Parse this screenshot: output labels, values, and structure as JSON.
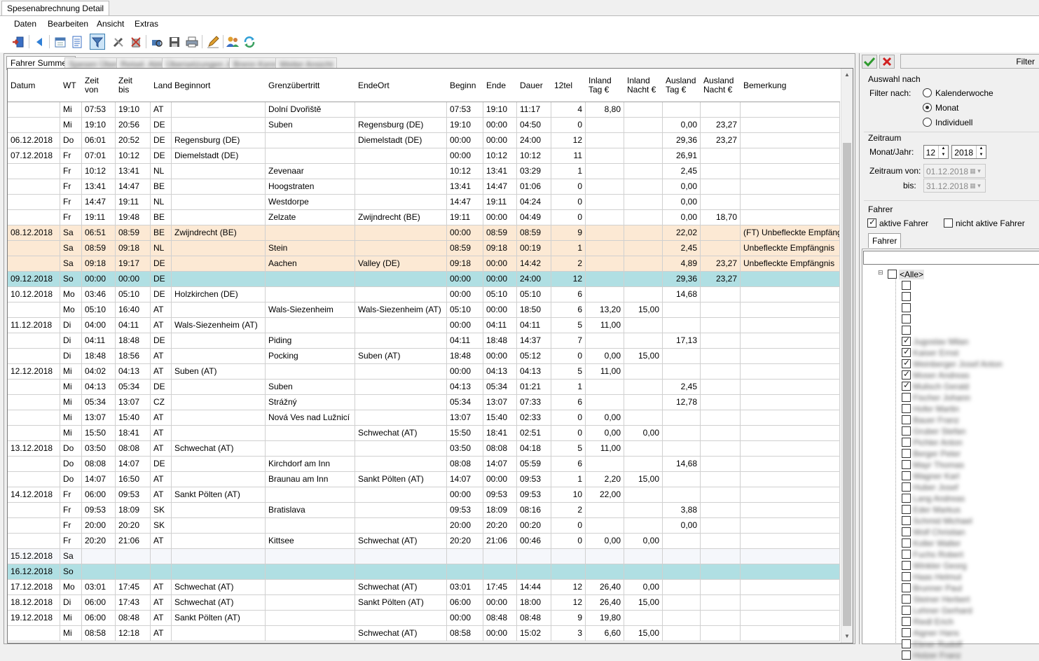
{
  "window": {
    "title": "Spesenabrechnung Detail"
  },
  "menu": [
    "Daten",
    "Bearbeiten",
    "Ansicht",
    "Extras"
  ],
  "toolbar": [
    "exit-icon",
    "back-icon",
    "calendar-icon",
    "document-icon",
    "filter-icon",
    "tools-icon",
    "delete-icon",
    "print-preview-icon",
    "save-icon",
    "print-icon",
    "edit-icon",
    "users-icon",
    "refresh-icon"
  ],
  "tabs": [
    "Fahrer Summen",
    "Spesen Übers",
    "Reisel. Ablst",
    "Übersetzungen Jeo",
    "Brenn Kennz",
    "Weiter Ansicht"
  ],
  "columns": [
    "Datum",
    "WT",
    "Zeit\nvon",
    "Zeit\nbis",
    "Land",
    "Beginnort",
    "Grenzübertritt",
    "EndeOrt",
    "Beginn",
    "Ende",
    "Dauer",
    "12tel",
    "Inland\nTag €",
    "Inland\nNacht €",
    "Ausland\nTag €",
    "Ausland\nNacht €",
    "Bemerkung"
  ],
  "rows": [
    {
      "type": "normal",
      "cells": [
        "",
        "Mi",
        "07:53",
        "19:10",
        "AT",
        "",
        "Dolní Dvořiště",
        "",
        "07:53",
        "19:10",
        "11:17",
        "4",
        "8,80",
        "",
        "",
        "",
        ""
      ]
    },
    {
      "type": "normal",
      "cells": [
        "",
        "Mi",
        "19:10",
        "20:56",
        "DE",
        "",
        "Suben",
        "Regensburg (DE)",
        "19:10",
        "00:00",
        "04:50",
        "0",
        "",
        "",
        "0,00",
        "23,27",
        ""
      ]
    },
    {
      "type": "normal",
      "cells": [
        "06.12.2018",
        "Do",
        "06:01",
        "20:52",
        "DE",
        "Regensburg (DE)",
        "",
        "Diemelstadt (DE)",
        "00:00",
        "00:00",
        "24:00",
        "12",
        "",
        "",
        "29,36",
        "23,27",
        ""
      ]
    },
    {
      "type": "normal",
      "cells": [
        "07.12.2018",
        "Fr",
        "07:01",
        "10:12",
        "DE",
        "Diemelstadt (DE)",
        "",
        "",
        "00:00",
        "10:12",
        "10:12",
        "11",
        "",
        "",
        "26,91",
        "",
        ""
      ]
    },
    {
      "type": "normal",
      "cells": [
        "",
        "Fr",
        "10:12",
        "13:41",
        "NL",
        "",
        "Zevenaar",
        "",
        "10:12",
        "13:41",
        "03:29",
        "1",
        "",
        "",
        "2,45",
        "",
        ""
      ]
    },
    {
      "type": "normal",
      "cells": [
        "",
        "Fr",
        "13:41",
        "14:47",
        "BE",
        "",
        "Hoogstraten",
        "",
        "13:41",
        "14:47",
        "01:06",
        "0",
        "",
        "",
        "0,00",
        "",
        ""
      ]
    },
    {
      "type": "normal",
      "cells": [
        "",
        "Fr",
        "14:47",
        "19:11",
        "NL",
        "",
        "Westdorpe",
        "",
        "14:47",
        "19:11",
        "04:24",
        "0",
        "",
        "",
        "0,00",
        "",
        ""
      ]
    },
    {
      "type": "normal",
      "cells": [
        "",
        "Fr",
        "19:11",
        "19:48",
        "BE",
        "",
        "Zelzate",
        "Zwijndrecht (BE)",
        "19:11",
        "00:00",
        "04:49",
        "0",
        "",
        "",
        "0,00",
        "18,70",
        ""
      ]
    },
    {
      "type": "holiday",
      "cells": [
        "08.12.2018",
        "Sa",
        "06:51",
        "08:59",
        "BE",
        "Zwijndrecht (BE)",
        "",
        "",
        "00:00",
        "08:59",
        "08:59",
        "9",
        "",
        "",
        "22,02",
        "",
        "(FT) Unbefleckte Empfängnis"
      ]
    },
    {
      "type": "holiday",
      "cells": [
        "",
        "Sa",
        "08:59",
        "09:18",
        "NL",
        "",
        "Stein",
        "",
        "08:59",
        "09:18",
        "00:19",
        "1",
        "",
        "",
        "2,45",
        "",
        "Unbefleckte Empfängnis"
      ]
    },
    {
      "type": "holiday",
      "cells": [
        "",
        "Sa",
        "09:18",
        "19:17",
        "DE",
        "",
        "Aachen",
        "Valley (DE)",
        "09:18",
        "00:00",
        "14:42",
        "2",
        "",
        "",
        "4,89",
        "23,27",
        "Unbefleckte Empfängnis"
      ]
    },
    {
      "type": "sunday",
      "cells": [
        "09.12.2018",
        "So",
        "00:00",
        "00:00",
        "DE",
        "",
        "",
        "",
        "00:00",
        "00:00",
        "24:00",
        "12",
        "",
        "",
        "29,36",
        "23,27",
        ""
      ]
    },
    {
      "type": "normal",
      "cells": [
        "10.12.2018",
        "Mo",
        "03:46",
        "05:10",
        "DE",
        "Holzkirchen (DE)",
        "",
        "",
        "00:00",
        "05:10",
        "05:10",
        "6",
        "",
        "",
        "14,68",
        "",
        ""
      ]
    },
    {
      "type": "normal",
      "cells": [
        "",
        "Mo",
        "05:10",
        "16:40",
        "AT",
        "",
        "Wals-Siezenheim",
        "Wals-Siezenheim (AT)",
        "05:10",
        "00:00",
        "18:50",
        "6",
        "13,20",
        "15,00",
        "",
        "",
        ""
      ]
    },
    {
      "type": "normal",
      "cells": [
        "11.12.2018",
        "Di",
        "04:00",
        "04:11",
        "AT",
        "Wals-Siezenheim (AT)",
        "",
        "",
        "00:00",
        "04:11",
        "04:11",
        "5",
        "11,00",
        "",
        "",
        "",
        ""
      ]
    },
    {
      "type": "normal",
      "cells": [
        "",
        "Di",
        "04:11",
        "18:48",
        "DE",
        "",
        "Piding",
        "",
        "04:11",
        "18:48",
        "14:37",
        "7",
        "",
        "",
        "17,13",
        "",
        ""
      ]
    },
    {
      "type": "normal",
      "cells": [
        "",
        "Di",
        "18:48",
        "18:56",
        "AT",
        "",
        "Pocking",
        "Suben (AT)",
        "18:48",
        "00:00",
        "05:12",
        "0",
        "0,00",
        "15,00",
        "",
        "",
        ""
      ]
    },
    {
      "type": "normal",
      "cells": [
        "12.12.2018",
        "Mi",
        "04:02",
        "04:13",
        "AT",
        "Suben (AT)",
        "",
        "",
        "00:00",
        "04:13",
        "04:13",
        "5",
        "11,00",
        "",
        "",
        "",
        ""
      ]
    },
    {
      "type": "normal",
      "cells": [
        "",
        "Mi",
        "04:13",
        "05:34",
        "DE",
        "",
        "Suben",
        "",
        "04:13",
        "05:34",
        "01:21",
        "1",
        "",
        "",
        "2,45",
        "",
        ""
      ]
    },
    {
      "type": "normal",
      "cells": [
        "",
        "Mi",
        "05:34",
        "13:07",
        "CZ",
        "",
        "Strážný",
        "",
        "05:34",
        "13:07",
        "07:33",
        "6",
        "",
        "",
        "12,78",
        "",
        ""
      ]
    },
    {
      "type": "normal",
      "cells": [
        "",
        "Mi",
        "13:07",
        "15:40",
        "AT",
        "",
        "Nová Ves nad Lužnicí",
        "",
        "13:07",
        "15:40",
        "02:33",
        "0",
        "0,00",
        "",
        "",
        "",
        ""
      ]
    },
    {
      "type": "normal",
      "cells": [
        "",
        "Mi",
        "15:50",
        "18:41",
        "AT",
        "",
        "",
        "Schwechat (AT)",
        "15:50",
        "18:41",
        "02:51",
        "0",
        "0,00",
        "0,00",
        "",
        "",
        ""
      ]
    },
    {
      "type": "normal",
      "cells": [
        "13.12.2018",
        "Do",
        "03:50",
        "08:08",
        "AT",
        "Schwechat (AT)",
        "",
        "",
        "03:50",
        "08:08",
        "04:18",
        "5",
        "11,00",
        "",
        "",
        "",
        ""
      ]
    },
    {
      "type": "normal",
      "cells": [
        "",
        "Do",
        "08:08",
        "14:07",
        "DE",
        "",
        "Kirchdorf am Inn",
        "",
        "08:08",
        "14:07",
        "05:59",
        "6",
        "",
        "",
        "14,68",
        "",
        ""
      ]
    },
    {
      "type": "normal",
      "cells": [
        "",
        "Do",
        "14:07",
        "16:50",
        "AT",
        "",
        "Braunau am Inn",
        "Sankt Pölten (AT)",
        "14:07",
        "00:00",
        "09:53",
        "1",
        "2,20",
        "15,00",
        "",
        "",
        ""
      ]
    },
    {
      "type": "normal",
      "cells": [
        "14.12.2018",
        "Fr",
        "06:00",
        "09:53",
        "AT",
        "Sankt Pölten (AT)",
        "",
        "",
        "00:00",
        "09:53",
        "09:53",
        "10",
        "22,00",
        "",
        "",
        "",
        ""
      ]
    },
    {
      "type": "normal",
      "cells": [
        "",
        "Fr",
        "09:53",
        "18:09",
        "SK",
        "",
        "Bratislava",
        "",
        "09:53",
        "18:09",
        "08:16",
        "2",
        "",
        "",
        "3,88",
        "",
        ""
      ]
    },
    {
      "type": "normal",
      "cells": [
        "",
        "Fr",
        "20:00",
        "20:20",
        "SK",
        "",
        "",
        "",
        "20:00",
        "20:20",
        "00:20",
        "0",
        "",
        "",
        "0,00",
        "",
        ""
      ]
    },
    {
      "type": "normal",
      "cells": [
        "",
        "Fr",
        "20:20",
        "21:06",
        "AT",
        "",
        "Kittsee",
        "Schwechat (AT)",
        "20:20",
        "21:06",
        "00:46",
        "0",
        "0,00",
        "0,00",
        "",
        "",
        ""
      ]
    },
    {
      "type": "weekend",
      "cells": [
        "15.12.2018",
        "Sa",
        "",
        "",
        "",
        "",
        "",
        "",
        "",
        "",
        "",
        "",
        "",
        "",
        "",
        "",
        ""
      ]
    },
    {
      "type": "sunday",
      "cells": [
        "16.12.2018",
        "So",
        "",
        "",
        "",
        "",
        "",
        "",
        "",
        "",
        "",
        "",
        "",
        "",
        "",
        "",
        ""
      ]
    },
    {
      "type": "normal",
      "cells": [
        "17.12.2018",
        "Mo",
        "03:01",
        "17:45",
        "AT",
        "Schwechat (AT)",
        "",
        "Schwechat (AT)",
        "03:01",
        "17:45",
        "14:44",
        "12",
        "26,40",
        "0,00",
        "",
        "",
        ""
      ]
    },
    {
      "type": "normal",
      "cells": [
        "18.12.2018",
        "Di",
        "06:00",
        "17:43",
        "AT",
        "Schwechat (AT)",
        "",
        "Sankt Pölten (AT)",
        "06:00",
        "00:00",
        "18:00",
        "12",
        "26,40",
        "15,00",
        "",
        "",
        ""
      ]
    },
    {
      "type": "normal",
      "cells": [
        "19.12.2018",
        "Mi",
        "06:00",
        "08:48",
        "AT",
        "Sankt Pölten (AT)",
        "",
        "",
        "00:00",
        "08:48",
        "08:48",
        "9",
        "19,80",
        "",
        "",
        "",
        ""
      ]
    },
    {
      "type": "normal",
      "cells": [
        "",
        "Mi",
        "08:58",
        "12:18",
        "AT",
        "",
        "",
        "Schwechat (AT)",
        "08:58",
        "00:00",
        "15:02",
        "3",
        "6,60",
        "15,00",
        "",
        "",
        ""
      ]
    }
  ],
  "filter": {
    "title": "Filter",
    "auswahl_label": "Auswahl nach",
    "filter_nach_label": "Filter nach:",
    "options": [
      "Kalenderwoche",
      "Monat",
      "Individuell"
    ],
    "selected": "Monat",
    "zeitraum_label": "Zeitraum",
    "monat_jahr_label": "Monat/Jahr:",
    "month": "12",
    "year": "2018",
    "zeitraum_von_label": "Zeitraum von:",
    "von": "01.12.2018",
    "bis_label": "bis:",
    "bis": "31.12.2018",
    "fahrer_label": "Fahrer",
    "aktive_label": "aktive Fahrer",
    "aktive_checked": true,
    "nicht_aktive_label": "nicht aktive Fahrer",
    "nicht_aktive_checked": false,
    "tab_label": "Fahrer",
    "tree_root": "<Alle>",
    "drivers": [
      {
        "name": "",
        "checked": false
      },
      {
        "name": "",
        "checked": false
      },
      {
        "name": "",
        "checked": false
      },
      {
        "name": "",
        "checked": false
      },
      {
        "name": "",
        "checked": false
      },
      {
        "name": "Jugoslav Milan",
        "checked": true
      },
      {
        "name": "Kaiser Ernst",
        "checked": true
      },
      {
        "name": "Weinberger Josef Anton",
        "checked": true
      },
      {
        "name": "Moser Andreas",
        "checked": true
      },
      {
        "name": "Mulisch Gerald",
        "checked": true
      },
      {
        "name": "Fischer Johann",
        "checked": false
      },
      {
        "name": "Hofer Martin",
        "checked": false
      },
      {
        "name": "Bauer Franz",
        "checked": false
      },
      {
        "name": "Gruber Stefan",
        "checked": false
      },
      {
        "name": "Pichler Anton",
        "checked": false
      },
      {
        "name": "Berger Peter",
        "checked": false
      },
      {
        "name": "Mayr Thomas",
        "checked": false
      },
      {
        "name": "Wagner Karl",
        "checked": false
      },
      {
        "name": "Huber Josef",
        "checked": false
      },
      {
        "name": "Lang Andreas",
        "checked": false
      },
      {
        "name": "Eder Markus",
        "checked": false
      },
      {
        "name": "Schmid Michael",
        "checked": false
      },
      {
        "name": "Wolf Christian",
        "checked": false
      },
      {
        "name": "Koller Walter",
        "checked": false
      },
      {
        "name": "Fuchs Robert",
        "checked": false
      },
      {
        "name": "Winkler Georg",
        "checked": false
      },
      {
        "name": "Haas Helmut",
        "checked": false
      },
      {
        "name": "Brunner Paul",
        "checked": false
      },
      {
        "name": "Steiner Herbert",
        "checked": false
      },
      {
        "name": "Lehner Gerhard",
        "checked": false
      },
      {
        "name": "Riedl Erich",
        "checked": false
      },
      {
        "name": "Aigner Hans",
        "checked": false
      },
      {
        "name": "Ebner Rudolf",
        "checked": false
      },
      {
        "name": "Holzer Franz",
        "checked": false
      }
    ]
  }
}
